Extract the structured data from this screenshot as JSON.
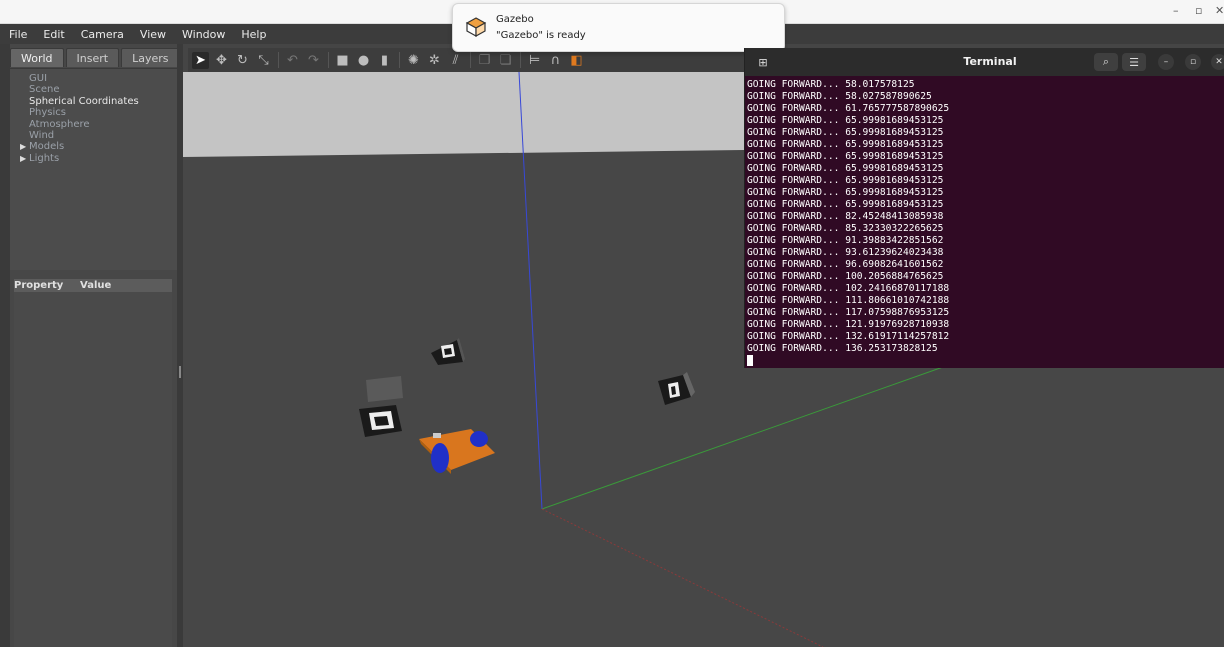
{
  "menubar": {
    "items": [
      "File",
      "Edit",
      "Camera",
      "View",
      "Window",
      "Help"
    ]
  },
  "left_panel": {
    "tabs": [
      "World",
      "Insert",
      "Layers"
    ],
    "tree": [
      {
        "label": "GUI",
        "expandable": false
      },
      {
        "label": "Scene",
        "expandable": false
      },
      {
        "label": "Spherical Coordinates",
        "expandable": false
      },
      {
        "label": "Physics",
        "expandable": false
      },
      {
        "label": "Atmosphere",
        "expandable": false
      },
      {
        "label": "Wind",
        "expandable": false
      },
      {
        "label": "Models",
        "expandable": true
      },
      {
        "label": "Lights",
        "expandable": true
      }
    ],
    "property_header": {
      "property": "Property",
      "value": "Value"
    }
  },
  "toolbar": {
    "icons": [
      "select-arrow-icon",
      "translate-icon",
      "rotate-icon",
      "scale-icon",
      "undo-icon",
      "redo-icon",
      "box-shape-icon",
      "sphere-shape-icon",
      "cylinder-shape-icon",
      "point-light-icon",
      "spot-light-icon",
      "directional-light-icon",
      "copy-icon",
      "paste-icon",
      "align-icon",
      "snap-icon",
      "change-view-icon"
    ]
  },
  "notification": {
    "title": "Gazebo",
    "body": "\"Gazebo\" is ready"
  },
  "terminal": {
    "title": "Terminal",
    "lines": [
      "GOING FORWARD... 58.017578125",
      "GOING FORWARD... 58.027587890625",
      "GOING FORWARD... 61.765777587890625",
      "GOING FORWARD... 65.99981689453125",
      "GOING FORWARD... 65.99981689453125",
      "GOING FORWARD... 65.99981689453125",
      "GOING FORWARD... 65.99981689453125",
      "GOING FORWARD... 65.99981689453125",
      "GOING FORWARD... 65.99981689453125",
      "GOING FORWARD... 65.99981689453125",
      "GOING FORWARD... 65.99981689453125",
      "GOING FORWARD... 82.45248413085938",
      "GOING FORWARD... 85.32330322265625",
      "GOING FORWARD... 91.39883422851562",
      "GOING FORWARD... 93.61239624023438",
      "GOING FORWARD... 96.69082641601562",
      "GOING FORWARD... 100.2056884765625",
      "GOING FORWARD... 102.24166870117188",
      "GOING FORWARD... 111.80661010742188",
      "GOING FORWARD... 117.07598876953125",
      "GOING FORWARD... 121.91976928710938",
      "GOING FORWARD... 132.61917114257812",
      "GOING FORWARD... 136.253173828125"
    ]
  },
  "colors": {
    "terminal_bg": "#300a24",
    "viewport_ground": "#474747",
    "viewport_sky": "#c0c0c0",
    "axis_z": "#3040d0",
    "axis_y": "#3a9a3a",
    "axis_x": "#9a3a3a",
    "robot_body": "#d9761e",
    "robot_wheels": "#2030c8"
  }
}
